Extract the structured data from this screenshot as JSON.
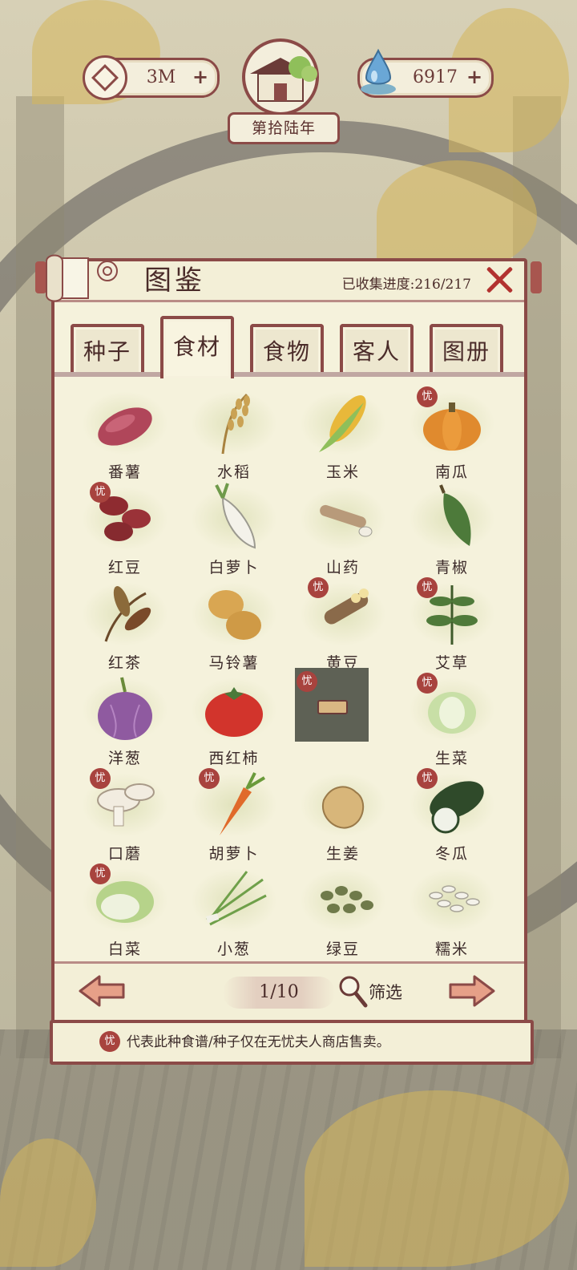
{
  "currency": {
    "coins": "3M",
    "water": "6917"
  },
  "year": "第拾陆年",
  "panel": {
    "title": "图鉴",
    "progress": "已收集进度:216/217"
  },
  "tabs": [
    "种子",
    "食材",
    "食物",
    "客人",
    "图册"
  ],
  "active_tab": 1,
  "items": [
    {
      "name": "番薯",
      "icon": "sweet-potato",
      "exclusive": false
    },
    {
      "name": "水稻",
      "icon": "rice",
      "exclusive": false
    },
    {
      "name": "玉米",
      "icon": "corn",
      "exclusive": false
    },
    {
      "name": "南瓜",
      "icon": "pumpkin",
      "exclusive": true
    },
    {
      "name": "红豆",
      "icon": "red-bean",
      "exclusive": true
    },
    {
      "name": "白萝卜",
      "icon": "radish",
      "exclusive": false
    },
    {
      "name": "山药",
      "icon": "yam",
      "exclusive": false
    },
    {
      "name": "青椒",
      "icon": "green-pepper",
      "exclusive": false
    },
    {
      "name": "红茶",
      "icon": "tea",
      "exclusive": false
    },
    {
      "name": "马铃薯",
      "icon": "potato",
      "exclusive": false
    },
    {
      "name": "黄豆",
      "icon": "soybean",
      "exclusive": true
    },
    {
      "name": "艾草",
      "icon": "mugwort",
      "exclusive": true
    },
    {
      "name": "洋葱",
      "icon": "onion",
      "exclusive": false
    },
    {
      "name": "西红柿",
      "icon": "tomato",
      "exclusive": false
    },
    {
      "name": "",
      "icon": "locked",
      "exclusive": true,
      "locked": true
    },
    {
      "name": "生菜",
      "icon": "lettuce",
      "exclusive": true
    },
    {
      "name": "口蘑",
      "icon": "mushroom",
      "exclusive": true
    },
    {
      "name": "胡萝卜",
      "icon": "carrot",
      "exclusive": true
    },
    {
      "name": "生姜",
      "icon": "ginger",
      "exclusive": false
    },
    {
      "name": "冬瓜",
      "icon": "winter-melon",
      "exclusive": true
    },
    {
      "name": "白菜",
      "icon": "cabbage",
      "exclusive": true
    },
    {
      "name": "小葱",
      "icon": "scallion",
      "exclusive": false
    },
    {
      "name": "绿豆",
      "icon": "mung-bean",
      "exclusive": false
    },
    {
      "name": "糯米",
      "icon": "glutinous-rice",
      "exclusive": false
    }
  ],
  "badge_char": "忧",
  "footer": {
    "page": "1/10",
    "filter_label": "筛选"
  },
  "hint": "代表此种食谱/种子仅在无忧夫人商店售卖。",
  "colors": {
    "frame": "#8b4a47",
    "paper": "#f5f2dc",
    "badge": "#a8433e",
    "close": "#b2322f"
  }
}
